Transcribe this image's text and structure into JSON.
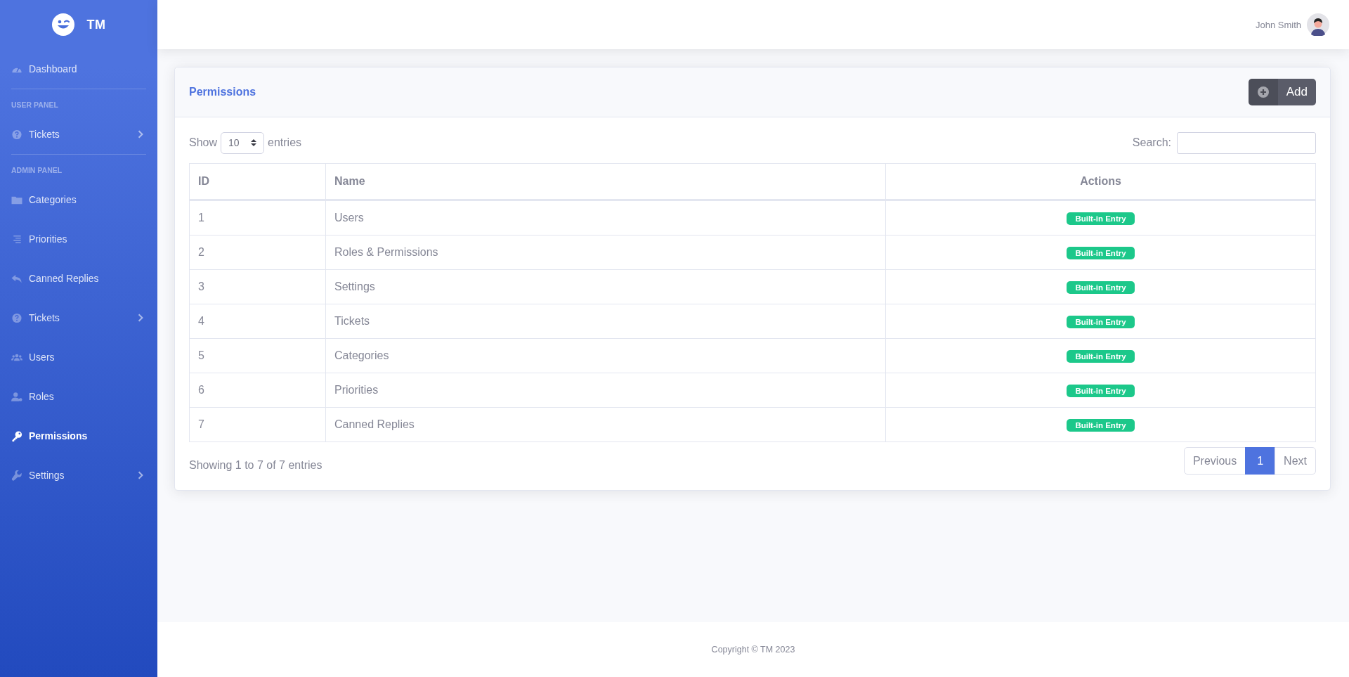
{
  "brand": {
    "title": "TM"
  },
  "sidebar": {
    "items": [
      {
        "kind": "link",
        "label": "Dashboard",
        "selected": false,
        "expandable": false
      },
      {
        "kind": "divider"
      },
      {
        "kind": "heading",
        "label": "USER PANEL"
      },
      {
        "kind": "link",
        "label": "Tickets",
        "selected": false,
        "expandable": true
      },
      {
        "kind": "divider"
      },
      {
        "kind": "heading",
        "label": "ADMIN PANEL"
      },
      {
        "kind": "link",
        "label": "Categories",
        "selected": false,
        "expandable": false
      },
      {
        "kind": "link",
        "label": "Priorities",
        "selected": false,
        "expandable": false
      },
      {
        "kind": "link",
        "label": "Canned Replies",
        "selected": false,
        "expandable": false
      },
      {
        "kind": "link",
        "label": "Tickets",
        "selected": false,
        "expandable": true
      },
      {
        "kind": "link",
        "label": "Users",
        "selected": false,
        "expandable": false
      },
      {
        "kind": "link",
        "label": "Roles",
        "selected": false,
        "expandable": false
      },
      {
        "kind": "link",
        "label": "Permissions",
        "selected": true,
        "expandable": false
      },
      {
        "kind": "link",
        "label": "Settings",
        "selected": false,
        "expandable": true
      }
    ]
  },
  "topbar": {
    "user_name": "John Smith"
  },
  "card": {
    "title": "Permissions",
    "add_button": "Add",
    "length": {
      "before": "Show",
      "value": "10",
      "after": "entries"
    },
    "search": {
      "label": "Search:"
    },
    "table": {
      "columns": [
        "ID",
        "Name",
        "Actions"
      ],
      "rows": [
        {
          "id": "1",
          "name": "Users",
          "badge": "Built-in Entry"
        },
        {
          "id": "2",
          "name": "Roles & Permissions",
          "badge": "Built-in Entry"
        },
        {
          "id": "3",
          "name": "Settings",
          "badge": "Built-in Entry"
        },
        {
          "id": "4",
          "name": "Tickets",
          "badge": "Built-in Entry"
        },
        {
          "id": "5",
          "name": "Categories",
          "badge": "Built-in Entry"
        },
        {
          "id": "6",
          "name": "Priorities",
          "badge": "Built-in Entry"
        },
        {
          "id": "7",
          "name": "Canned Replies",
          "badge": "Built-in Entry"
        }
      ]
    },
    "info": "Showing 1 to 7 of 7 entries",
    "pagination": [
      {
        "label": "Previous",
        "selected": false
      },
      {
        "label": "1",
        "selected": true
      },
      {
        "label": "Next",
        "selected": false
      }
    ]
  },
  "footer": {
    "text": "Copyright © TM 2023"
  }
}
